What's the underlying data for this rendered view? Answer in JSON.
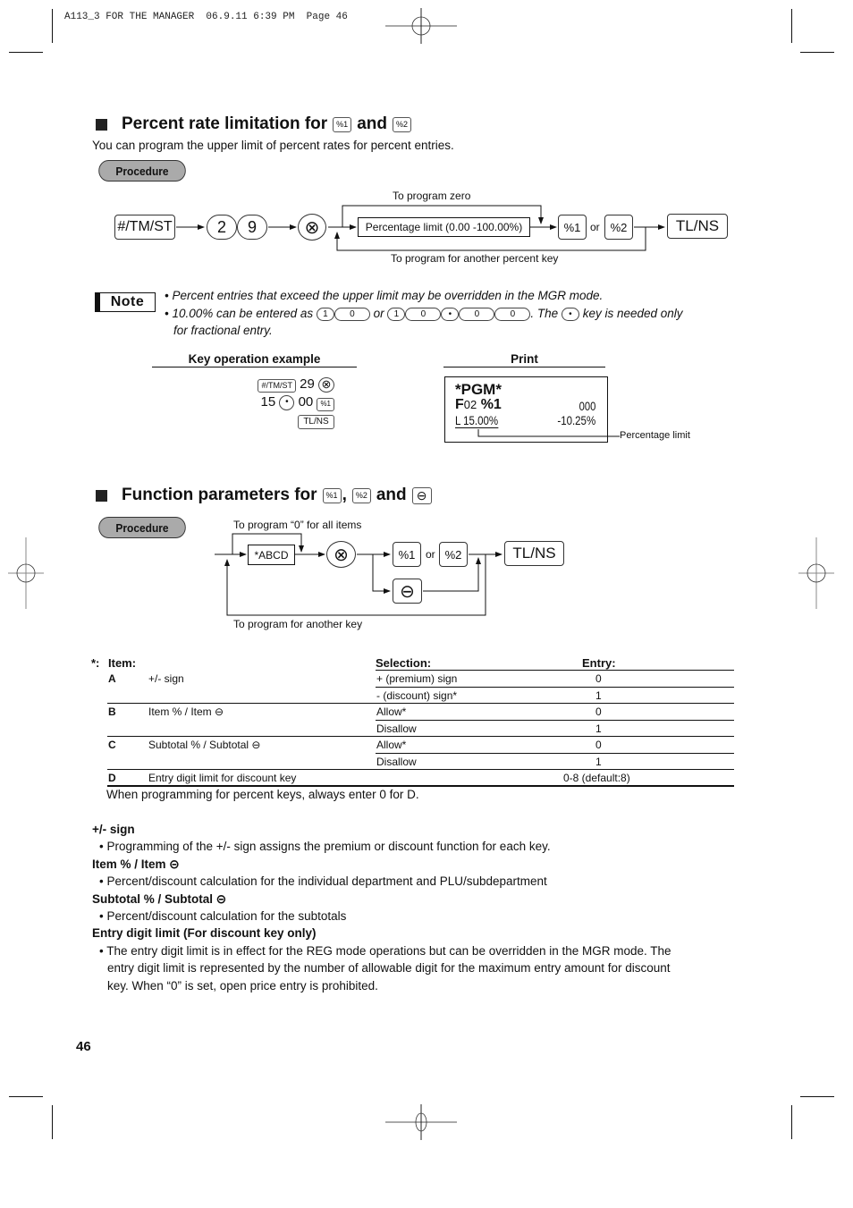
{
  "print_header": "A113_3 FOR THE MANAGER  06.9.11 6:39 PM  Page 46",
  "section1": {
    "title_prefix": "Percent rate limitation for",
    "title_and": "and",
    "key_pct1": "%1",
    "key_pct2": "%2",
    "description": "You can program the upper limit of percent rates for percent entries.",
    "procedure_label": "Procedure",
    "flow": {
      "start_key": "#/TM/ST",
      "digit1": "2",
      "digit2": "9",
      "multiply_key": "⊗",
      "limit_box": "Percentage limit (0.00 -100.00%)",
      "label_top": "To program zero",
      "label_bottom": "To program for another percent key",
      "key_pct1": "%1",
      "or": "or",
      "key_pct2": "%2",
      "end_key": "TL/NS"
    }
  },
  "note": {
    "badge": "Note",
    "bullet1": "• Percent entries that exceed the upper limit may be overridden in the MGR mode.",
    "bullet2_a": "• 10.00% can be entered as",
    "bullet2_or": "or",
    "bullet2_b": ".  The",
    "bullet2_c": "key is needed only",
    "bullet2_d": "for fractional entry.",
    "keys_a": [
      "1",
      "0"
    ],
    "keys_b": [
      "1",
      "0",
      "•",
      "0",
      "0"
    ],
    "dot_key": "•"
  },
  "example": {
    "heading": "Key operation example",
    "line1_key": "#/TM/ST",
    "line1_num": "29",
    "line1_op": "⊗",
    "line2_num1": "15",
    "line2_dot": "•",
    "line2_num2": "00",
    "line2_key": "%1",
    "line3_key": "TL/NS"
  },
  "print": {
    "heading": "Print",
    "line1": "*PGM*",
    "line2_left_big": "F",
    "line2_left_small": "02",
    "line2_left_tail": " %1",
    "line2_right": "000",
    "line3_left": "L 15.00%",
    "line3_right": "-10.25%",
    "callout": "Percentage limit"
  },
  "section2": {
    "title_prefix": "Function parameters for",
    "key_pct1": "%1",
    "comma": ",",
    "key_pct2": "%2",
    "title_and": "and",
    "key_minus": "⊖",
    "procedure_label": "Procedure",
    "flow": {
      "label_top": "To program “0” for all items",
      "abcd_box": "*ABCD",
      "multiply_key": "⊗",
      "key_pct1": "%1",
      "or": "or",
      "key_pct2": "%2",
      "minus_key": "⊖",
      "end_key": "TL/NS",
      "label_bottom": "To program for another key"
    }
  },
  "table": {
    "star": "*:",
    "headers": {
      "item": "Item:",
      "selection": "Selection:",
      "entry": "Entry:"
    },
    "rows": [
      {
        "code": "A",
        "item": "+/- sign",
        "selection": "+ (premium) sign",
        "entry": "0"
      },
      {
        "code": "",
        "item": "",
        "selection": "- (discount) sign*",
        "entry": "1"
      },
      {
        "code": "B",
        "item": "Item % / Item ⊖",
        "selection": "Allow*",
        "entry": "0"
      },
      {
        "code": "",
        "item": "",
        "selection": "Disallow",
        "entry": "1"
      },
      {
        "code": "C",
        "item": "Subtotal % / Subtotal ⊖",
        "selection": "Allow*",
        "entry": "0"
      },
      {
        "code": "",
        "item": "",
        "selection": "Disallow",
        "entry": "1"
      },
      {
        "code": "D",
        "item": "Entry digit limit for discount key",
        "selection": "",
        "entry": "0-8 (default:8)"
      }
    ],
    "footnote": "When programming for percent keys, always enter 0 for D."
  },
  "explanations": [
    {
      "heading": "+/- sign",
      "lines": [
        "• Programming of the +/- sign assigns the premium or discount function for each key."
      ]
    },
    {
      "heading": "Item % / Item ⊝",
      "lines": [
        "• Percent/discount calculation for the individual department and PLU/subdepartment"
      ]
    },
    {
      "heading": "Subtotal % / Subtotal ⊝",
      "lines": [
        "• Percent/discount calculation for the subtotals"
      ]
    },
    {
      "heading": "Entry digit limit (For discount key only)",
      "lines": [
        "• The entry digit limit is in effect for the REG mode operations but can be overridden in the MGR mode.  The",
        "entry digit limit is represented by the number of allowable digit for the maximum entry amount for discount",
        "key.  When “0” is set, open price entry is prohibited."
      ]
    }
  ],
  "page_number": "46"
}
